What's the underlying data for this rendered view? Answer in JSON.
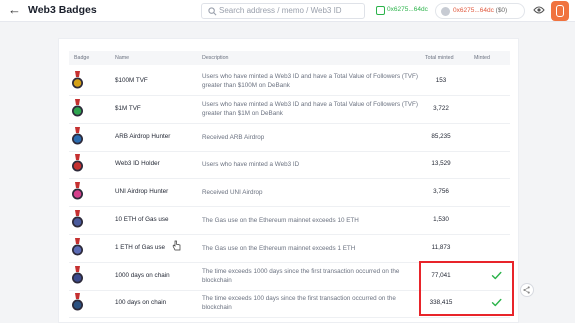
{
  "header": {
    "back_icon": "arrow-left-icon",
    "title": "Web3 Badges",
    "search_placeholder": "Search address / memo / Web3 ID",
    "wallet_address": "0x6275...64dc",
    "account_address": "0x6275...64dc",
    "account_balance": "($0)",
    "accent_color": "#2bb34a",
    "avatar_color": "#f0733f"
  },
  "table": {
    "columns": {
      "badge": "Badge",
      "name": "Name",
      "description": "Description",
      "total_minted": "Total minted",
      "minted": "Minted"
    },
    "rows": [
      {
        "name": "$100M TVF",
        "description": "Users who have minted a Web3 ID and have a Total Value of Followers (TVF) greater than $100M on DeBank",
        "total": "153",
        "minted": false,
        "badge_color": "#d4a017"
      },
      {
        "name": "$1M TVF",
        "description": "Users who have minted a Web3 ID and have a Total Value of Followers (TVF) greater than $1M on DeBank",
        "total": "3,722",
        "minted": false,
        "badge_color": "#2ea44f"
      },
      {
        "name": "ARB Airdrop Hunter",
        "description": "Received ARB Airdrop",
        "total": "85,235",
        "minted": false,
        "badge_color": "#2b6cb0"
      },
      {
        "name": "Web3 ID Holder",
        "description": "Users who have minted a Web3 ID",
        "total": "13,529",
        "minted": false,
        "badge_color": "#c53030"
      },
      {
        "name": "UNI Airdrop Hunter",
        "description": "Received UNI Airdrop",
        "total": "3,756",
        "minted": false,
        "badge_color": "#d53f8c"
      },
      {
        "name": "10 ETH of Gas use",
        "description": "The Gas use on the Ethereum mainnet exceeds 10 ETH",
        "total": "1,530",
        "minted": false,
        "badge_color": "#4a5a9c"
      },
      {
        "name": "1 ETH of Gas use",
        "description": "The Gas use on the Ethereum mainnet exceeds 1 ETH",
        "total": "11,873",
        "minted": false,
        "badge_color": "#5b6bb5"
      },
      {
        "name": "1000 days on chain",
        "description": "The time exceeds 1000 days since the first transaction occurred on the blockchain",
        "total": "77,041",
        "minted": true,
        "badge_color": "#3b4a8c"
      },
      {
        "name": "100 days on chain",
        "description": "The time exceeds 100 days since the first transaction occurred on the blockchain",
        "total": "338,415",
        "minted": true,
        "badge_color": "#2c5282"
      }
    ]
  },
  "check_color": "#2bb34a",
  "highlight_color": "#e8242a"
}
